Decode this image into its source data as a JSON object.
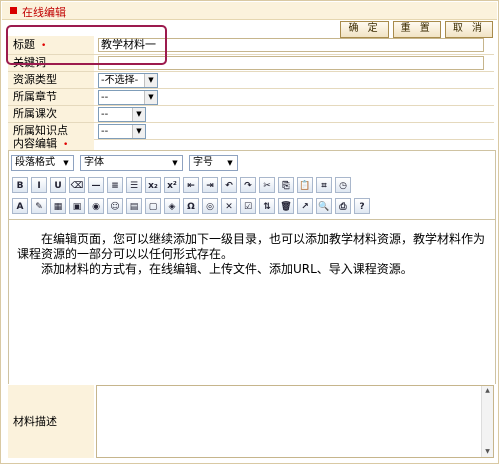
{
  "panel": {
    "title": "在线编辑"
  },
  "toolbar": {
    "confirm": "确 定",
    "reset": "重 置",
    "cancel": "取 消"
  },
  "form": {
    "title_label": "标题",
    "title_value": "教学材料一",
    "keywords_label": "关键词",
    "keywords_value": "",
    "resource_type_label": "资源类型",
    "resource_type_value": "-不选择-",
    "chapter_label": "所属章节",
    "chapter_value": "--",
    "lesson_label": "所属课次",
    "lesson_value": "--",
    "knowledge_label": "所属知识点",
    "knowledge_value": "--",
    "content_label": "内容编辑",
    "required_mark": "•"
  },
  "editor": {
    "paragraph_format": "段落格式",
    "font": "字体",
    "font_size": "字号",
    "row1_buttons": [
      "B",
      "I",
      "U",
      "⌫",
      "—",
      "≡",
      "☰",
      "x₂",
      "x²",
      "⇤",
      "⇥",
      "↶",
      "↷",
      "✂",
      "⎘",
      "📋",
      "⌗",
      "◷"
    ],
    "row1_icons": [
      "bold-icon",
      "italic-icon",
      "underline-icon",
      "eraser-icon",
      "hr-icon",
      "align-icon",
      "list-icon",
      "subscript-icon",
      "superscript-icon",
      "outdent-icon",
      "indent-icon",
      "undo-icon",
      "redo-icon",
      "cut-icon",
      "copy-icon",
      "paste-icon",
      "paste-word-icon",
      "time-icon"
    ],
    "row2_buttons": [
      "A",
      "✎",
      "▦",
      "▣",
      "◉",
      "☺",
      "▤",
      "▢",
      "◈",
      "Ω",
      "◎",
      "✕",
      "☑",
      "⇅",
      "🗑",
      "↗",
      "🔍",
      "⎙",
      "?"
    ],
    "row2_icons": [
      "font-color-icon",
      "highlight-icon",
      "table-icon",
      "image-icon",
      "media-icon",
      "emoticon-icon",
      "flash-icon",
      "frame-icon",
      "link-icon",
      "special-char-icon",
      "anchor-icon",
      "unlink-icon",
      "checkbox-icon",
      "sort-icon",
      "delete-icon",
      "export-icon",
      "preview-icon",
      "print-icon",
      "help-icon"
    ],
    "paragraphs": [
      "在编辑页面，您可以继续添加下一级目录，也可以添加教学材料资源，教学材料作为课程资源的一部分可以以任何形式存在。",
      "添加材料的方式有，在线编辑、上传文件、添加URL、导入课程资源。"
    ]
  },
  "description": {
    "label": "材料描述",
    "value": ""
  },
  "colors": {
    "accent": "#c00000",
    "label_bg": "#fbf2dc",
    "highlight_border": "#9c1a4d"
  }
}
